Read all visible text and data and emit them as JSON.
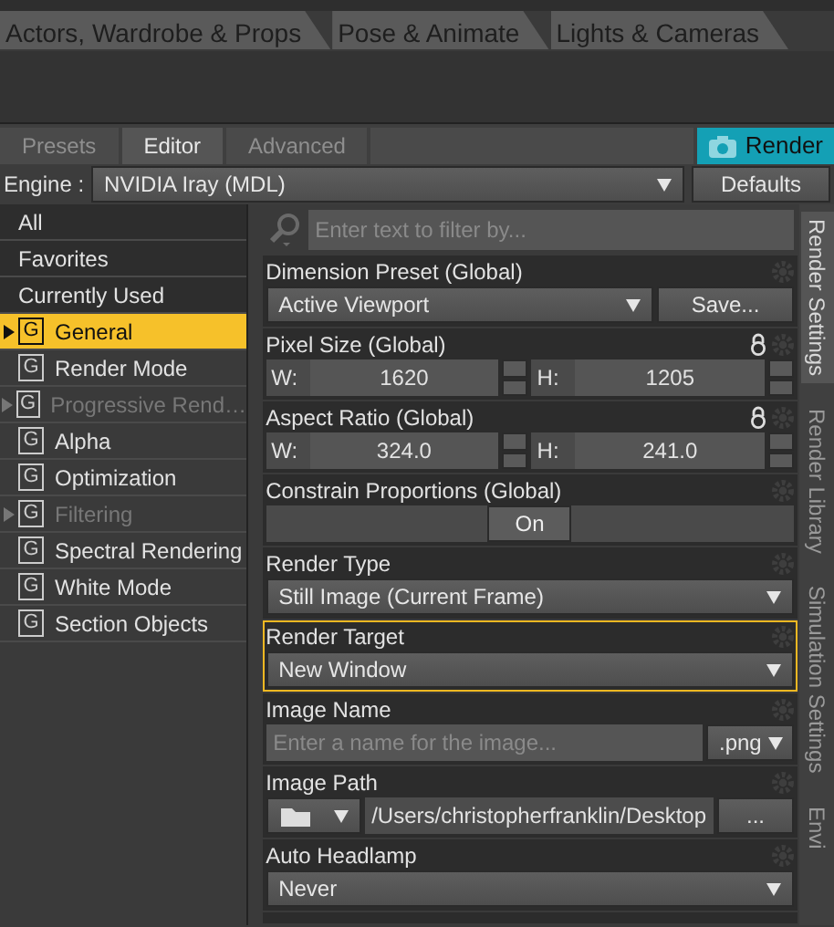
{
  "top_tabs": [
    {
      "label": "Actors, Wardrobe & Props"
    },
    {
      "label": "Pose & Animate"
    },
    {
      "label": "Lights & Cameras"
    }
  ],
  "pane_tabs": [
    {
      "label": "Presets",
      "selected": false
    },
    {
      "label": "Editor",
      "selected": true
    },
    {
      "label": "Advanced",
      "selected": false
    }
  ],
  "render_button": {
    "label": "Render"
  },
  "engine": {
    "label": "Engine :",
    "value": "NVIDIA Iray (MDL)",
    "button": "Defaults"
  },
  "filters": [
    {
      "label": "All"
    },
    {
      "label": "Favorites"
    },
    {
      "label": "Currently Used"
    }
  ],
  "groups": [
    {
      "badge": "G",
      "label": "General",
      "selected": true,
      "expandable": true,
      "disabled": false
    },
    {
      "badge": "G",
      "label": "Render Mode",
      "selected": false,
      "expandable": false,
      "disabled": false
    },
    {
      "badge": "G",
      "label": "Progressive Rend…",
      "selected": false,
      "expandable": true,
      "disabled": true
    },
    {
      "badge": "G",
      "label": "Alpha",
      "selected": false,
      "expandable": false,
      "disabled": false
    },
    {
      "badge": "G",
      "label": "Optimization",
      "selected": false,
      "expandable": false,
      "disabled": false
    },
    {
      "badge": "G",
      "label": "Filtering",
      "selected": false,
      "expandable": true,
      "disabled": true
    },
    {
      "badge": "G",
      "label": "Spectral Rendering",
      "selected": false,
      "expandable": false,
      "disabled": false
    },
    {
      "badge": "G",
      "label": "White Mode",
      "selected": false,
      "expandable": false,
      "disabled": false
    },
    {
      "badge": "G",
      "label": "Section Objects",
      "selected": false,
      "expandable": false,
      "disabled": false
    }
  ],
  "filter_field": {
    "placeholder": "Enter text to filter by..."
  },
  "settings": [
    {
      "kind": "preset",
      "title": "Dimension Preset (Global)",
      "value": "Active Viewport",
      "button": "Save...",
      "highlighted": false
    },
    {
      "kind": "pair",
      "title": "Pixel Size (Global)",
      "locked": true,
      "highlighted": false,
      "fields": [
        {
          "label": "W:",
          "value": "1620"
        },
        {
          "label": "H:",
          "value": "1205"
        }
      ]
    },
    {
      "kind": "pair",
      "title": "Aspect Ratio (Global)",
      "locked": true,
      "highlighted": false,
      "fields": [
        {
          "label": "W:",
          "value": "324.0"
        },
        {
          "label": "H:",
          "value": "241.0"
        }
      ]
    },
    {
      "kind": "toggle",
      "title": "Constrain Proportions (Global)",
      "value": "On",
      "highlighted": false
    },
    {
      "kind": "dropdown",
      "title": "Render Type",
      "value": "Still Image (Current Frame)",
      "highlighted": false
    },
    {
      "kind": "dropdown",
      "title": "Render Target",
      "value": "New Window",
      "highlighted": true
    },
    {
      "kind": "name",
      "title": "Image Name",
      "placeholder": "Enter a name for the image...",
      "format": ".png",
      "highlighted": false
    },
    {
      "kind": "path",
      "title": "Image Path",
      "value": "/Users/christopherfranklin/Desktop",
      "button": "...",
      "highlighted": false
    },
    {
      "kind": "dropdown",
      "title": "Auto Headlamp",
      "value": "Never",
      "highlighted": false
    }
  ],
  "side_tabs": [
    {
      "label": "Render Settings",
      "selected": true
    },
    {
      "label": "Render Library",
      "selected": false
    },
    {
      "label": "Simulation Settings",
      "selected": false
    },
    {
      "label": "Envi",
      "selected": false
    }
  ]
}
